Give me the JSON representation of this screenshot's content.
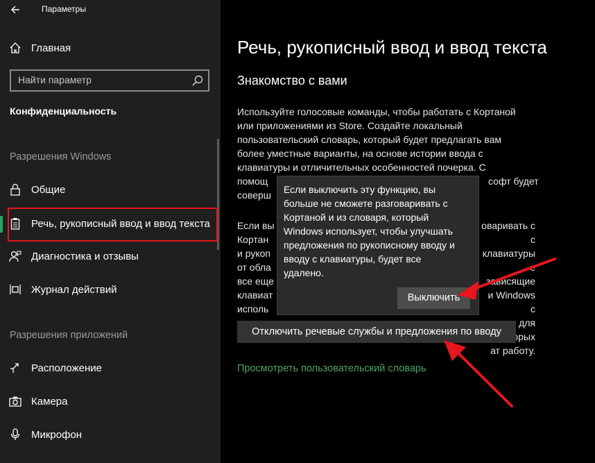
{
  "window": {
    "title": "Параметры"
  },
  "sidebar": {
    "home_label": "Главная",
    "search": {
      "placeholder": "Найти параметр"
    },
    "current_section": "Конфиденциальность",
    "group_windows": "Разрешения Windows",
    "group_apps": "Разрешения приложений",
    "items_windows": [
      {
        "label": "Общие",
        "icon": "lock-icon"
      },
      {
        "label": "Речь, рукописный ввод и ввод текста",
        "icon": "clipboard-icon",
        "selected": true
      },
      {
        "label": "Диагностика и отзывы",
        "icon": "feedback-person-icon"
      },
      {
        "label": "Журнал действий",
        "icon": "timeline-icon"
      }
    ],
    "items_apps": [
      {
        "label": "Расположение",
        "icon": "location-icon"
      },
      {
        "label": "Камера",
        "icon": "camera-icon"
      },
      {
        "label": "Микрофон",
        "icon": "microphone-icon"
      }
    ]
  },
  "main": {
    "title": "Речь, рукописный ввод и ввод текста",
    "subtitle": "Знакомство с вами",
    "paragraph1_lines": [
      "Используйте голосовые команды, чтобы работать с Кортаной",
      "или приложениями из Store. Создайте локальный",
      "пользовательский словарь, который будет предлагать вам",
      "более уместные варианты, на основе истории ввода с",
      "клавиатуры и отличительных особенностей почерка. С",
      "помощ",
      "соверш"
    ],
    "paragraph1_right_fragment": "софт будет",
    "paragraph2_lines": [
      "Если вы",
      "Кортан",
      "и рукоп",
      "от обла",
      "все еще",
      "клавиат",
      "исполь"
    ],
    "paragraph2_right_fragments": [
      "оваривать с",
      "с клавиатуры",
      "е зависящие",
      "и Windows",
      "с",
      "для которых",
      "ат работу."
    ],
    "action_button": "Отключить речевые службы и предложения по вводу",
    "dictionary_link": "Просмотреть пользовательский словарь"
  },
  "flyout": {
    "lines": [
      "Если выключить эту функцию, вы",
      "больше не сможете разговаривать с",
      "Кортаной и из словаря, который",
      "Windows использует, чтобы улучшать",
      "предложения по рукописному вводу и",
      "вводу с клавиатуры, будет все",
      "удалено."
    ],
    "confirm_button": "Выключить"
  },
  "colors": {
    "sidebar_bg": "#1f1f1f",
    "main_bg": "#000000",
    "accent_green": "#2aa36a",
    "link_green": "#4aa565",
    "annotation_red": "#e5161e"
  }
}
